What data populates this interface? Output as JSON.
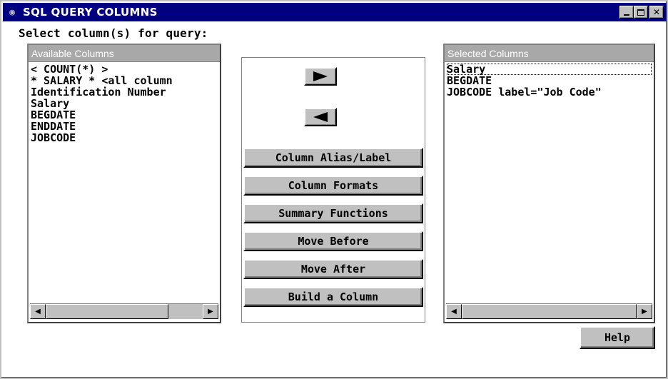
{
  "window": {
    "title": "SQL QUERY COLUMNS",
    "icon": "sas-icon",
    "controls": {
      "minimize": "minimize-icon",
      "maximize": "maximize-icon",
      "close": "✕"
    }
  },
  "prompt": "Select column(s) for query:",
  "available": {
    "header": "Available Columns",
    "items": [
      "< COUNT(*) >",
      "* SALARY * <all column",
      "Identification Number",
      "Salary",
      "BEGDATE",
      "ENDDATE",
      "JOBCODE"
    ]
  },
  "selected": {
    "header": "Selected Columns",
    "items": [
      "Salary",
      "BEGDATE",
      "JOBCODE label=\"Job Code\""
    ]
  },
  "buttons": {
    "column_alias": "Column Alias/Label",
    "column_formats": "Column Formats",
    "summary_functions": "Summary Functions",
    "move_before": "Move Before",
    "move_after": "Move After",
    "build_column": "Build a Column",
    "help": "Help"
  },
  "scroll": {
    "left": "◀",
    "right": "▶"
  }
}
